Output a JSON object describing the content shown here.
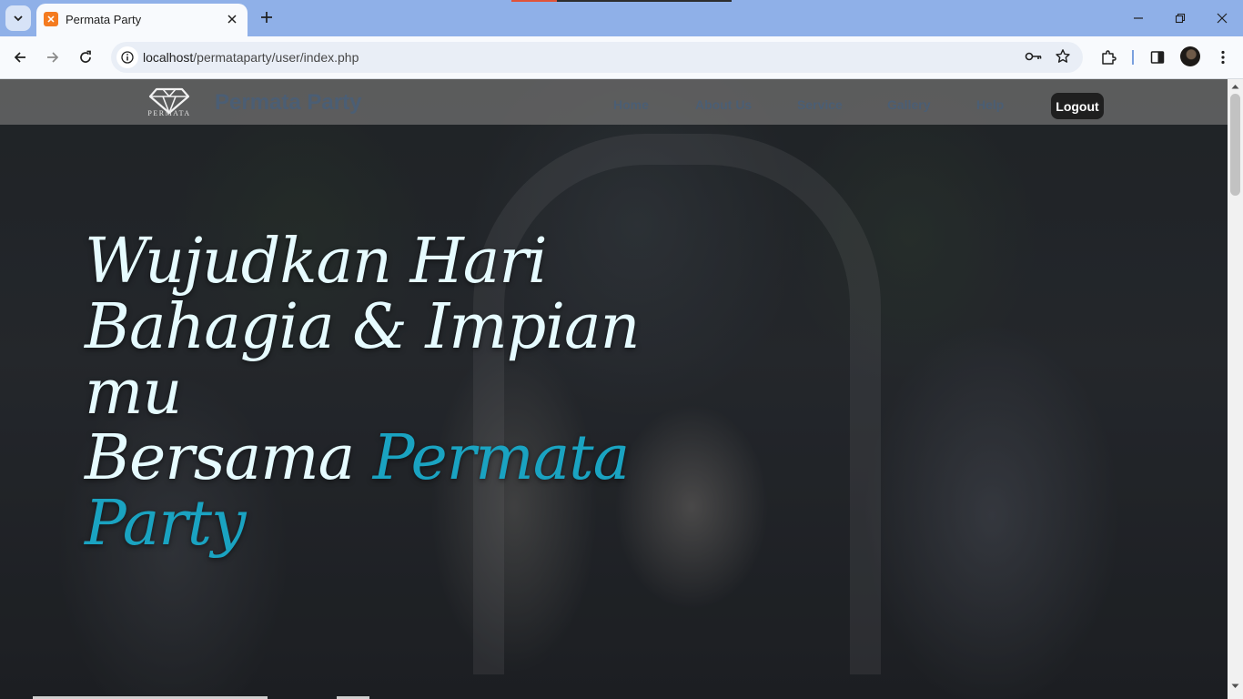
{
  "browser": {
    "tab_title": "Permata Party",
    "url_host": "localhost",
    "url_path": "/permataparty/user/index.php"
  },
  "site": {
    "logo_text": "PERMATA",
    "brand": "Permata Party",
    "nav": [
      "Home",
      "About Us",
      "Service",
      "Gallery",
      "Help"
    ],
    "logout": "Logout"
  },
  "hero": {
    "line1": "Wujudkan Hari",
    "line2": "Bahagia & Impian mu",
    "line3": "Bersama ",
    "accent": "Permata Party"
  },
  "colors": {
    "tab_strip": "#8fb0e8",
    "brand_text": "#4b5e74",
    "accent": "#1aa3c1",
    "headline": "#e6fbff",
    "logout_bg": "#1f1f1f"
  }
}
